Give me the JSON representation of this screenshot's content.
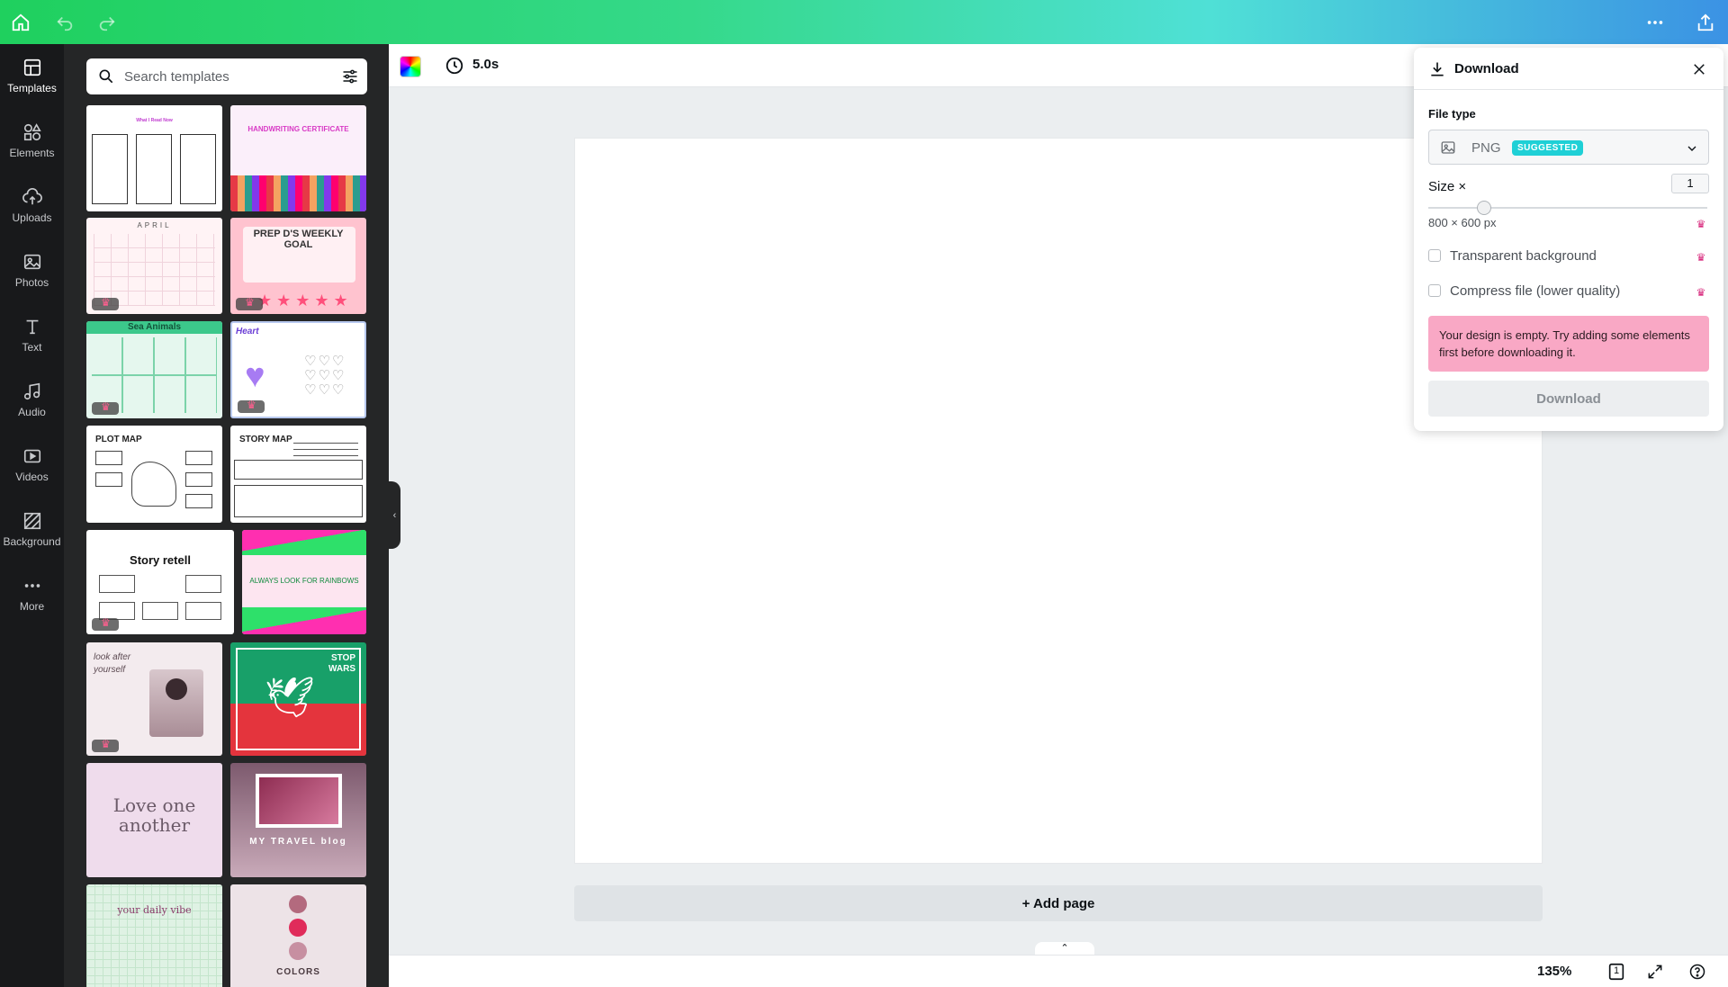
{
  "topbar": {
    "icons": [
      "home-icon",
      "undo-icon",
      "redo-icon",
      "more-horizontal-icon",
      "share-icon"
    ]
  },
  "rail": {
    "items": [
      {
        "label": "Templates",
        "icon": "templates-icon",
        "active": true
      },
      {
        "label": "Elements",
        "icon": "elements-icon"
      },
      {
        "label": "Uploads",
        "icon": "uploads-icon"
      },
      {
        "label": "Photos",
        "icon": "photos-icon"
      },
      {
        "label": "Text",
        "icon": "text-icon"
      },
      {
        "label": "Audio",
        "icon": "audio-icon"
      },
      {
        "label": "Videos",
        "icon": "videos-icon"
      },
      {
        "label": "Background",
        "icon": "background-icon"
      },
      {
        "label": "More",
        "icon": "more-icon"
      }
    ]
  },
  "panel": {
    "search_placeholder": "Search templates",
    "templates": [
      {
        "title": "What I Read Now"
      },
      {
        "title": "HANDWRITING CERTIFICATE"
      },
      {
        "title": "APRIL"
      },
      {
        "title": "PREP D'S WEEKLY GOAL"
      },
      {
        "title": "Sea Animals"
      },
      {
        "title": "Heart"
      },
      {
        "title": "PLOT MAP"
      },
      {
        "title": "STORY MAP"
      },
      {
        "title": "Story retell"
      },
      {
        "title": "ALWAYS LOOK FOR RAINBOWS"
      },
      {
        "title": "look after yourself"
      },
      {
        "title": "STOP WARS"
      },
      {
        "title": "Love one another"
      },
      {
        "title": "MY TRAVEL blog"
      },
      {
        "title": "your daily vibe"
      },
      {
        "title": "COLORS"
      }
    ]
  },
  "editor": {
    "duration": "5.0s",
    "add_page": "+ Add page",
    "zoom": "135%",
    "page_count": "1"
  },
  "download": {
    "title": "Download",
    "file_type_label": "File type",
    "file_type_value": "PNG",
    "suggested_badge": "SUGGESTED",
    "size_label": "Size ×",
    "size_value": "1",
    "slider_fraction": 0.2,
    "dimensions": "800 × 600 px",
    "transparent_bg": "Transparent background",
    "compress": "Compress file (lower quality)",
    "alert": "Your design is empty. Try adding some elements first before downloading it.",
    "button": "Download"
  },
  "colors": {
    "accent": "#1fd0d6",
    "alert_bg": "#f9a8c5",
    "crown": "#d8297d"
  }
}
